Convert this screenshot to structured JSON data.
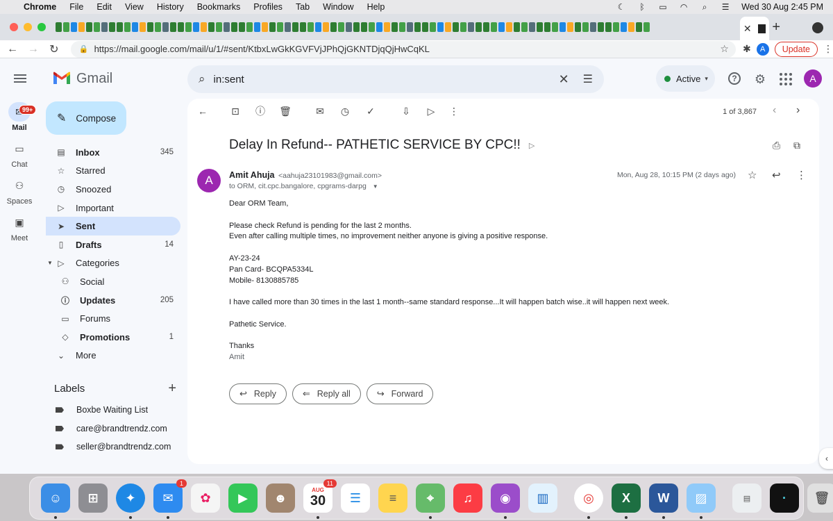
{
  "menubar": {
    "app": "Chrome",
    "items": [
      "File",
      "Edit",
      "View",
      "History",
      "Bookmarks",
      "Profiles",
      "Tab",
      "Window",
      "Help"
    ],
    "datetime": "Wed 30 Aug  2:45 PM"
  },
  "browser": {
    "url": "https://mail.google.com/mail/u/1/#sent/KtbxLwGkKGVFVjJPhQjGKNTDjqQjHwCqKL",
    "update_label": "Update",
    "profile_initial": "A"
  },
  "gmail": {
    "logo_text": "Gmail",
    "search_query": "in:sent",
    "status": "Active",
    "account_initial": "A",
    "compose_label": "Compose",
    "rail": [
      {
        "label": "Mail",
        "badge": "99+"
      },
      {
        "label": "Chat"
      },
      {
        "label": "Spaces"
      },
      {
        "label": "Meet"
      }
    ],
    "folders": [
      {
        "label": "Inbox",
        "count": "345"
      },
      {
        "label": "Starred",
        "count": ""
      },
      {
        "label": "Snoozed",
        "count": ""
      },
      {
        "label": "Important",
        "count": ""
      },
      {
        "label": "Sent",
        "count": ""
      },
      {
        "label": "Drafts",
        "count": "14"
      },
      {
        "label": "Categories",
        "count": ""
      },
      {
        "label": "Social",
        "count": ""
      },
      {
        "label": "Updates",
        "count": "205"
      },
      {
        "label": "Forums",
        "count": ""
      },
      {
        "label": "Promotions",
        "count": "1"
      },
      {
        "label": "More",
        "count": ""
      }
    ],
    "labels_title": "Labels",
    "labels": [
      "Boxbe Waiting List",
      "care@brandtrendz.com",
      "seller@brandtrendz.com"
    ]
  },
  "message": {
    "pager": "1 of 3,867",
    "subject": "Delay In Refund-- PATHETIC SERVICE BY CPC!!",
    "sender_initial": "A",
    "sender_name": "Amit Ahuja",
    "sender_email": "<aahuja23101983@gmail.com>",
    "to": "to ORM, cit.cpc.bangalore, cpgrams-darpg",
    "date": "Mon, Aug 28, 10:15 PM (2 days ago)",
    "body": {
      "greeting": "Dear ORM Team,",
      "line1": "Please check Refund is pending for the last 2 months.",
      "line2": "Even after calling multiple times, no improvement neither anyone is giving a positive response.",
      "ay": "AY-23-24",
      "pan": "Pan Card- BCQPA5334L",
      "mobile": "Mobile- 8130885785",
      "line3": "I have called more than 30 times in the last 1 month--same standard response...It will happen batch wise..it will happen next week.",
      "line4": "Pathetic Service.",
      "thanks": "Thanks",
      "sig": "Amit"
    },
    "reply_label": "Reply",
    "reply_all_label": "Reply all",
    "forward_label": "Forward"
  },
  "dock": {
    "mail_badge": "1",
    "calendar_month": "AUG",
    "calendar_day": "30",
    "calendar_badge": "11"
  },
  "colors": {
    "compose_bg": "#c2e7ff",
    "selected_bg": "#d3e3fd",
    "avatar": "#9c27b0",
    "active_dot": "#1e8e3e"
  }
}
